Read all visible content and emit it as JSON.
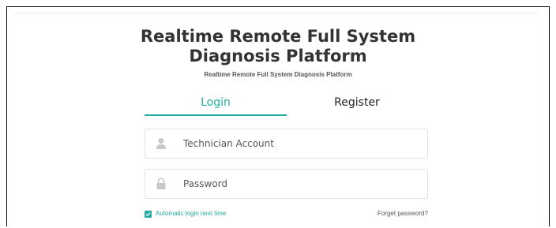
{
  "header": {
    "title_line1": "Realtime Remote Full System",
    "title_line2": "Diagnosis Platform",
    "subtitle": "Realtime Remote Full System Diagnosis Platform"
  },
  "tabs": [
    {
      "label": "Login",
      "active": true
    },
    {
      "label": "Register",
      "active": false
    }
  ],
  "form": {
    "account": {
      "placeholder": "Technician Account",
      "value": "",
      "icon": "user-icon"
    },
    "password": {
      "placeholder": "Password",
      "value": "",
      "icon": "lock-icon"
    },
    "remember": {
      "label": "Automatic login next time",
      "checked": true
    },
    "forgot_label": "Forget password?"
  },
  "colors": {
    "accent": "#22aba0",
    "title": "#333333",
    "icon": "#c8c8c8",
    "border": "#e3e3e3"
  }
}
